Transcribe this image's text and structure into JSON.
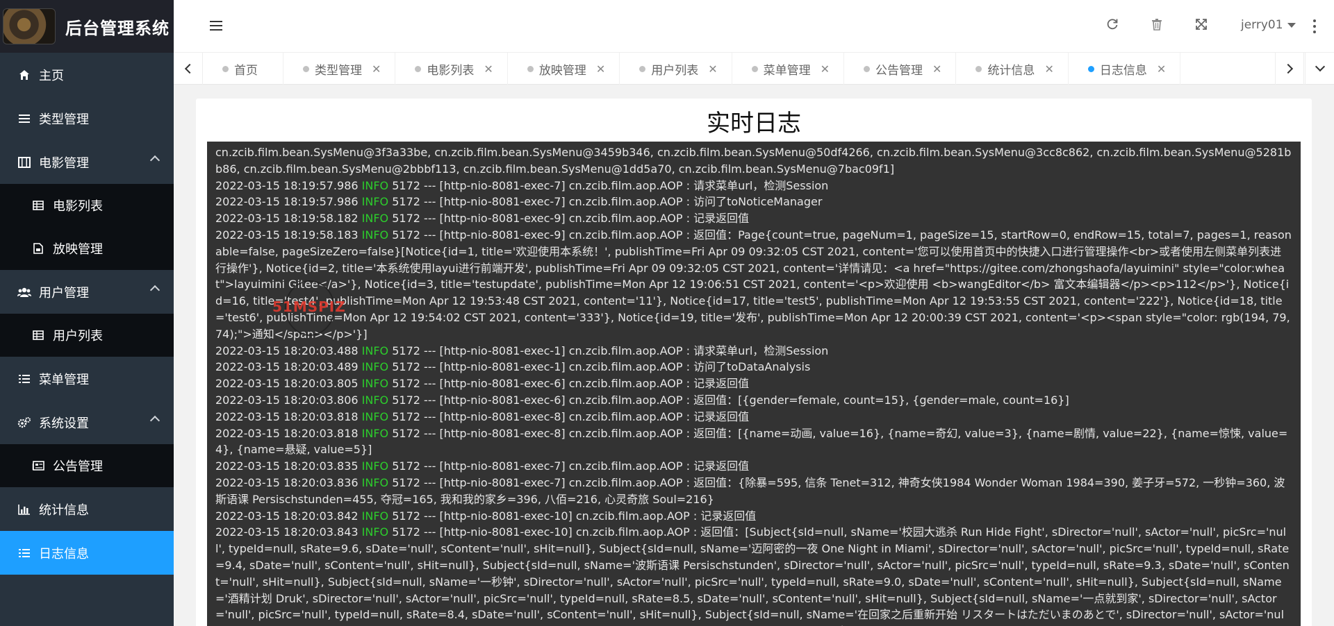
{
  "app": {
    "title": "后台管理系统"
  },
  "sidebar": {
    "items": [
      {
        "label": "主页",
        "icon": "home-icon"
      },
      {
        "label": "类型管理",
        "icon": "list-icon"
      },
      {
        "label": "电影管理",
        "icon": "film-icon",
        "expanded": true,
        "children": [
          {
            "label": "电影列表",
            "icon": "table-icon"
          },
          {
            "label": "放映管理",
            "icon": "file-icon"
          }
        ]
      },
      {
        "label": "用户管理",
        "icon": "users-icon",
        "expanded": true,
        "children": [
          {
            "label": "用户列表",
            "icon": "table-icon"
          }
        ]
      },
      {
        "label": "菜单管理",
        "icon": "menu-list-icon"
      },
      {
        "label": "系统设置",
        "icon": "gears-icon",
        "expanded": true,
        "children": [
          {
            "label": "公告管理",
            "icon": "newspaper-icon"
          }
        ]
      },
      {
        "label": "统计信息",
        "icon": "bar-chart-icon"
      },
      {
        "label": "日志信息",
        "icon": "list-icon",
        "active": true
      }
    ]
  },
  "header": {
    "user": "jerry01"
  },
  "tabs": [
    "首页",
    "类型管理",
    "电影列表",
    "放映管理",
    "用户列表",
    "菜单管理",
    "公告管理",
    "统计信息",
    "日志信息"
  ],
  "content": {
    "title": "实时日志",
    "log_lines": [
      {
        "text": "cn.zcib.film.bean.SysMenu@3f3a33be, cn.zcib.film.bean.SysMenu@3459b346, cn.zcib.film.bean.SysMenu@50df4266, cn.zcib.film.bean.SysMenu@3cc8c862, cn.zcib.film.bean.SysMenu@5281bb86, cn.zcib.film.bean.SysMenu@2bbbf113, cn.zcib.film.bean.SysMenu@1dd5a70, cn.zcib.film.bean.SysMenu@7bac09f1]"
      },
      {
        "ts": "2022-03-15 18:19:57.986",
        "level": "INFO",
        "rest": "5172 --- [http-nio-8081-exec-7] cn.zcib.film.aop.AOP : 请求菜单url，检测Session"
      },
      {
        "ts": "2022-03-15 18:19:57.986",
        "level": "INFO",
        "rest": "5172 --- [http-nio-8081-exec-7] cn.zcib.film.aop.AOP : 访问了toNoticeManager"
      },
      {
        "ts": "2022-03-15 18:19:58.182",
        "level": "INFO",
        "rest": "5172 --- [http-nio-8081-exec-9] cn.zcib.film.aop.AOP : 记录返回值"
      },
      {
        "ts": "2022-03-15 18:19:58.183",
        "level": "INFO",
        "rest": "5172 --- [http-nio-8081-exec-9] cn.zcib.film.aop.AOP : 返回值：Page{count=true, pageNum=1, pageSize=15, startRow=0, endRow=15, total=7, pages=1, reasonable=false, pageSizeZero=false}[Notice{id=1, title='欢迎使用本系统！', publishTime=Fri Apr 09 09:32:05 CST 2021, content='您可以使用首页中的快捷入口进行管理操作<br>或者使用左侧菜单列表进行操作'}, Notice{id=2, title='本系统使用layui进行前端开发', publishTime=Fri Apr 09 09:32:05 CST 2021, content='详情请见：<a href=\"https://gitee.com/zhongshaofa/layuimini\" style=\"color:wheat\">layuimini Gitee</a>'}, Notice{id=3, title='testupdate', publishTime=Mon Apr 12 19:06:51 CST 2021, content='<p>欢迎使用 <b>wangEditor</b> 富文本编辑器</p><p>112</p>'}, Notice{id=16, title='test4', publishTime=Mon Apr 12 19:53:48 CST 2021, content='11'}, Notice{id=17, title='test5', publishTime=Mon Apr 12 19:53:55 CST 2021, content='222'}, Notice{id=18, title='test6', publishTime=Mon Apr 12 19:54:02 CST 2021, content='333'}, Notice{id=19, title='发布', publishTime=Mon Apr 12 20:00:39 CST 2021, content='<p><span style=\"color: rgb(194, 79, 74);\">通知</span></p>'}]"
      },
      {
        "ts": "2022-03-15 18:20:03.488",
        "level": "INFO",
        "rest": "5172 --- [http-nio-8081-exec-1] cn.zcib.film.aop.AOP : 请求菜单url，检测Session"
      },
      {
        "ts": "2022-03-15 18:20:03.489",
        "level": "INFO",
        "rest": "5172 --- [http-nio-8081-exec-1] cn.zcib.film.aop.AOP : 访问了toDataAnalysis"
      },
      {
        "ts": "2022-03-15 18:20:03.805",
        "level": "INFO",
        "rest": "5172 --- [http-nio-8081-exec-6] cn.zcib.film.aop.AOP : 记录返回值"
      },
      {
        "ts": "2022-03-15 18:20:03.806",
        "level": "INFO",
        "rest": "5172 --- [http-nio-8081-exec-6] cn.zcib.film.aop.AOP : 返回值：[{gender=female, count=15}, {gender=male, count=16}]"
      },
      {
        "ts": "2022-03-15 18:20:03.818",
        "level": "INFO",
        "rest": "5172 --- [http-nio-8081-exec-8] cn.zcib.film.aop.AOP : 记录返回值"
      },
      {
        "ts": "2022-03-15 18:20:03.818",
        "level": "INFO",
        "rest": "5172 --- [http-nio-8081-exec-8] cn.zcib.film.aop.AOP : 返回值：[{name=动画, value=16}, {name=奇幻, value=3}, {name=剧情, value=22}, {name=惊悚, value=4}, {name=悬疑, value=5}]"
      },
      {
        "ts": "2022-03-15 18:20:03.835",
        "level": "INFO",
        "rest": "5172 --- [http-nio-8081-exec-7] cn.zcib.film.aop.AOP : 记录返回值"
      },
      {
        "ts": "2022-03-15 18:20:03.836",
        "level": "INFO",
        "rest": "5172 --- [http-nio-8081-exec-7] cn.zcib.film.aop.AOP : 返回值：{除暴=595, 信条 Tenet=312, 神奇女侠1984 Wonder Woman 1984=390, 姜子牙=572, 一秒钟=360, 波斯语课 Persischstunden=455, 夺冠=165, 我和我的家乡=396, 八佰=216, 心灵奇旅 Soul=216}"
      },
      {
        "ts": "2022-03-15 18:20:03.842",
        "level": "INFO",
        "rest": "5172 --- [http-nio-8081-exec-10] cn.zcib.film.aop.AOP : 记录返回值"
      },
      {
        "ts": "2022-03-15 18:20:03.843",
        "level": "INFO",
        "rest": "5172 --- [http-nio-8081-exec-10] cn.zcib.film.aop.AOP : 返回值：[Subject{sId=null, sName='校园大逃杀 Run Hide Fight', sDirector='null', sActor='null', picSrc='null', typeId=null, sRate=9.6, sDate='null', sContent='null', sHit=null}, Subject{sId=null, sName='迈阿密的一夜 One Night in Miami', sDirector='null', sActor='null', picSrc='null', typeId=null, sRate=9.4, sDate='null', sContent='null', sHit=null}, Subject{sId=null, sName='波斯语课 Persischstunden', sDirector='null', sActor='null', picSrc='null', typeId=null, sRate=9.3, sDate='null', sContent='null', sHit=null}, Subject{sId=null, sName='一秒钟', sDirector='null', sActor='null', picSrc='null', typeId=null, sRate=9.0, sDate='null', sContent='null', sHit=null}, Subject{sId=null, sName='酒精计划 Druk', sDirector='null', sActor='null', picSrc='null', typeId=null, sRate=8.5, sDate='null', sContent='null', sHit=null}, Subject{sId=null, sName='一点就到家', sDirector='null', sActor='null', picSrc='null', typeId=null, sRate=8.4, sDate='null', sContent='null', sHit=null}, Subject{sId=null, sName='在回家之后重新开始 リスタートはただいまのあとで', sDirector='null', sActor='null', picSrc='null', typeId=null, sRate=8.3, sDate='null', sContent='null', sHit=null}, Subject{sId=null, sName='八佰', sDirector='null', sActor='null', picSrc='null', typeId=null, sRate=8.3, sDate='null', sContent='null', sHit=null}, Subject{sId=null, sName='我和我"
      }
    ]
  },
  "watermark": {
    "text": "51MSPIZ"
  },
  "colors": {
    "sidebar": "#28333e",
    "accent": "#1e9fff",
    "log_bg": "#333333",
    "info": "#2ccd2c"
  }
}
